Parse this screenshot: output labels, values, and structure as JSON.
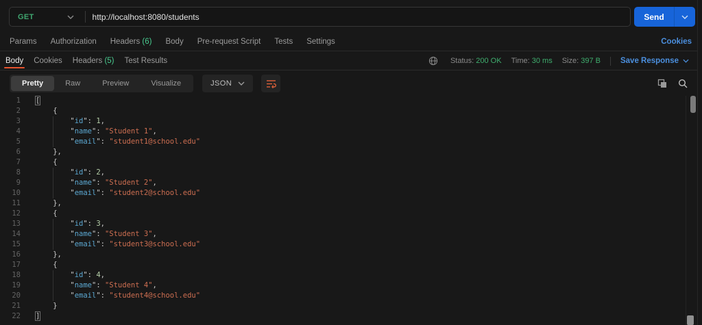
{
  "request": {
    "method": "GET",
    "url": "http://localhost:8080/students",
    "send_label": "Send",
    "tabs": [
      {
        "label": "Params"
      },
      {
        "label": "Authorization"
      },
      {
        "label": "Headers",
        "count": "(6)"
      },
      {
        "label": "Body"
      },
      {
        "label": "Pre-request Script"
      },
      {
        "label": "Tests"
      },
      {
        "label": "Settings"
      }
    ],
    "cookies_link": "Cookies"
  },
  "response": {
    "tabs": [
      {
        "label": "Body",
        "active": true
      },
      {
        "label": "Cookies"
      },
      {
        "label": "Headers",
        "count": "(5)"
      },
      {
        "label": "Test Results"
      }
    ],
    "meta": {
      "status_label": "Status:",
      "status_value": "200 OK",
      "time_label": "Time:",
      "time_value": "30 ms",
      "size_label": "Size:",
      "size_value": "397 B",
      "save_label": "Save Response"
    },
    "view_modes": [
      "Pretty",
      "Raw",
      "Preview",
      "Visualize"
    ],
    "active_mode": "Pretty",
    "language": "JSON"
  },
  "colors": {
    "accent_orange": "#e8542e",
    "method_green": "#3fa56f",
    "count_green": "#49cc90",
    "status_green": "#3fae6e",
    "link_blue": "#4b8fde",
    "send_blue": "#1764d9",
    "json_key": "#5ba7d1",
    "json_string": "#cd6e51",
    "json_number": "#b5cea8"
  },
  "code": {
    "lines": [
      {
        "n": 1,
        "i": 0,
        "t": [
          [
            "b",
            "["
          ]
        ]
      },
      {
        "n": 2,
        "i": 1,
        "t": [
          [
            "p",
            "{"
          ]
        ]
      },
      {
        "n": 3,
        "i": 2,
        "t": [
          [
            "p",
            "\""
          ],
          [
            "k",
            "id"
          ],
          [
            "p",
            "\": "
          ],
          [
            "n",
            "1"
          ],
          [
            "p",
            ","
          ]
        ]
      },
      {
        "n": 4,
        "i": 2,
        "t": [
          [
            "p",
            "\""
          ],
          [
            "k",
            "name"
          ],
          [
            "p",
            "\": "
          ],
          [
            "s",
            "\"Student 1\""
          ],
          [
            "p",
            ","
          ]
        ]
      },
      {
        "n": 5,
        "i": 2,
        "t": [
          [
            "p",
            "\""
          ],
          [
            "k",
            "email"
          ],
          [
            "p",
            "\": "
          ],
          [
            "s",
            "\"student1@school.edu\""
          ]
        ]
      },
      {
        "n": 6,
        "i": 1,
        "t": [
          [
            "p",
            "},"
          ]
        ]
      },
      {
        "n": 7,
        "i": 1,
        "t": [
          [
            "p",
            "{"
          ]
        ]
      },
      {
        "n": 8,
        "i": 2,
        "t": [
          [
            "p",
            "\""
          ],
          [
            "k",
            "id"
          ],
          [
            "p",
            "\": "
          ],
          [
            "n",
            "2"
          ],
          [
            "p",
            ","
          ]
        ]
      },
      {
        "n": 9,
        "i": 2,
        "t": [
          [
            "p",
            "\""
          ],
          [
            "k",
            "name"
          ],
          [
            "p",
            "\": "
          ],
          [
            "s",
            "\"Student 2\""
          ],
          [
            "p",
            ","
          ]
        ]
      },
      {
        "n": 10,
        "i": 2,
        "t": [
          [
            "p",
            "\""
          ],
          [
            "k",
            "email"
          ],
          [
            "p",
            "\": "
          ],
          [
            "s",
            "\"student2@school.edu\""
          ]
        ]
      },
      {
        "n": 11,
        "i": 1,
        "t": [
          [
            "p",
            "},"
          ]
        ]
      },
      {
        "n": 12,
        "i": 1,
        "t": [
          [
            "p",
            "{"
          ]
        ]
      },
      {
        "n": 13,
        "i": 2,
        "t": [
          [
            "p",
            "\""
          ],
          [
            "k",
            "id"
          ],
          [
            "p",
            "\": "
          ],
          [
            "n",
            "3"
          ],
          [
            "p",
            ","
          ]
        ]
      },
      {
        "n": 14,
        "i": 2,
        "t": [
          [
            "p",
            "\""
          ],
          [
            "k",
            "name"
          ],
          [
            "p",
            "\": "
          ],
          [
            "s",
            "\"Student 3\""
          ],
          [
            "p",
            ","
          ]
        ]
      },
      {
        "n": 15,
        "i": 2,
        "t": [
          [
            "p",
            "\""
          ],
          [
            "k",
            "email"
          ],
          [
            "p",
            "\": "
          ],
          [
            "s",
            "\"student3@school.edu\""
          ]
        ]
      },
      {
        "n": 16,
        "i": 1,
        "t": [
          [
            "p",
            "},"
          ]
        ]
      },
      {
        "n": 17,
        "i": 1,
        "t": [
          [
            "p",
            "{"
          ]
        ]
      },
      {
        "n": 18,
        "i": 2,
        "t": [
          [
            "p",
            "\""
          ],
          [
            "k",
            "id"
          ],
          [
            "p",
            "\": "
          ],
          [
            "n",
            "4"
          ],
          [
            "p",
            ","
          ]
        ]
      },
      {
        "n": 19,
        "i": 2,
        "t": [
          [
            "p",
            "\""
          ],
          [
            "k",
            "name"
          ],
          [
            "p",
            "\": "
          ],
          [
            "s",
            "\"Student 4\""
          ],
          [
            "p",
            ","
          ]
        ]
      },
      {
        "n": 20,
        "i": 2,
        "t": [
          [
            "p",
            "\""
          ],
          [
            "k",
            "email"
          ],
          [
            "p",
            "\": "
          ],
          [
            "s",
            "\"student4@school.edu\""
          ]
        ]
      },
      {
        "n": 21,
        "i": 1,
        "t": [
          [
            "p",
            "}"
          ]
        ]
      },
      {
        "n": 22,
        "i": 0,
        "t": [
          [
            "b",
            "]"
          ]
        ]
      }
    ]
  }
}
